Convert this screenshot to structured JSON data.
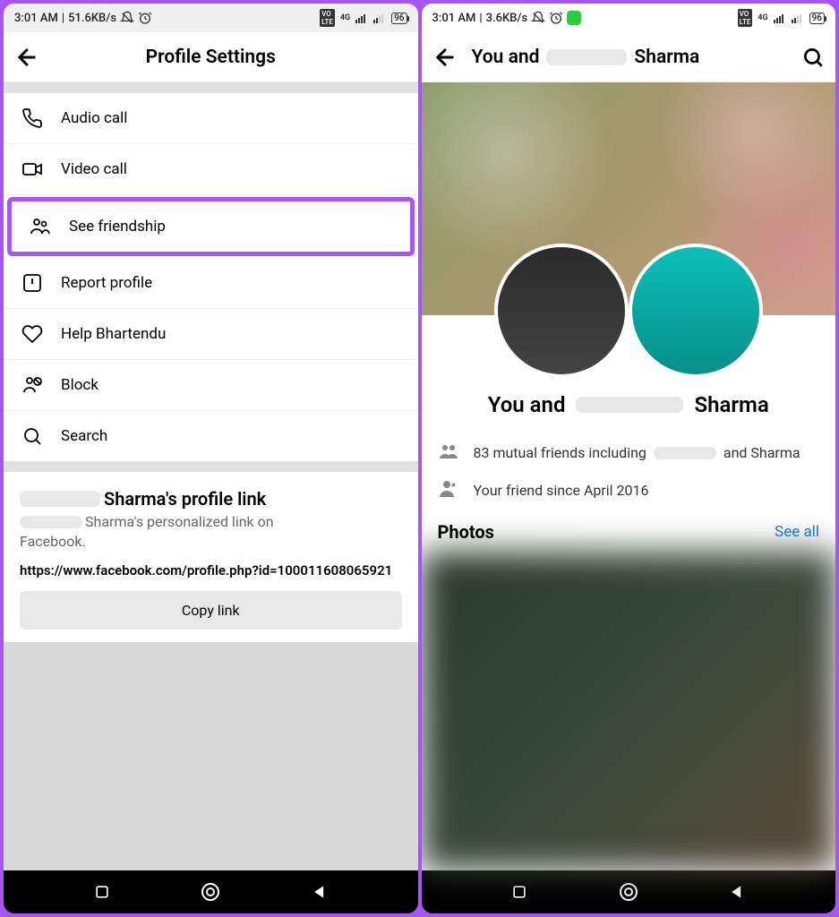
{
  "left": {
    "status": {
      "time": "3:01 AM",
      "speed": "51.6KB/s",
      "battery": "96"
    },
    "appbar": {
      "title": "Profile Settings"
    },
    "menu": [
      {
        "key": "audio-call",
        "label": "Audio call"
      },
      {
        "key": "video-call",
        "label": "Video call"
      },
      {
        "key": "see-friendship",
        "label": "See friendship",
        "highlighted": true
      },
      {
        "key": "report-profile",
        "label": "Report profile"
      },
      {
        "key": "help",
        "label": "Help Bhartendu"
      },
      {
        "key": "block",
        "label": "Block"
      },
      {
        "key": "search",
        "label": "Search"
      }
    ],
    "profileLink": {
      "title_suffix": "Sharma's profile link",
      "sub_suffix": "Sharma's personalized link on",
      "sub_end": "Facebook.",
      "url": "https://www.facebook.com/profile.php?id=100011608065921",
      "copy_label": "Copy link"
    }
  },
  "right": {
    "status": {
      "time": "3:01 AM",
      "speed": "3.6KB/s",
      "battery": "96"
    },
    "appbar": {
      "prefix": "You and",
      "suffix": "Sharma"
    },
    "friendship_title": {
      "prefix": "You and",
      "suffix": "Sharma"
    },
    "mutual": {
      "count": "83",
      "prefix": "mutual friends including",
      "suffix": "and Sharma"
    },
    "since": "Your friend since April 2016",
    "photos": {
      "label": "Photos",
      "seeall": "See all"
    }
  }
}
